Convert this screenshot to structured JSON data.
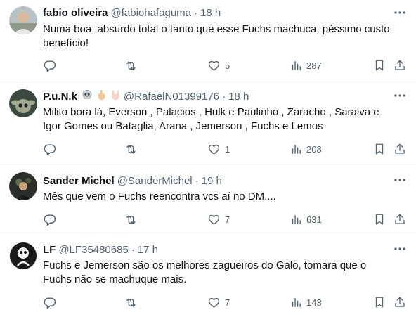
{
  "tweets": [
    {
      "name": "fabio oliveira",
      "handle": "@fabiohafaguma",
      "separator": "·",
      "time": "18 h",
      "text": "Numa boa, absurdo total o tanto que esse Fuchs machuca, péssimo custo benefício!",
      "likes": "5",
      "views": "287"
    },
    {
      "name": "P.u.N.k",
      "handle": "@RafaelN01399176",
      "separator": "·",
      "time": "18 h",
      "emoji_icons": [
        "skull-icon",
        "middle-finger-icon",
        "rock-hand-icon"
      ],
      "text": "Milito bora lá,  Everson , Palacios , Hulk e Paulinho , Zaracho , Saraiva e Igor Gomes ou Bataglia,  Arana , Jemerson , Fuchs e Lemos",
      "likes": "1",
      "views": "208"
    },
    {
      "name": "Sander Michel",
      "handle": "@SanderMichel",
      "separator": "·",
      "time": "19 h",
      "text": "Mês que vem o Fuchs reencontra vcs aí no DM....",
      "likes": "7",
      "views": "631"
    },
    {
      "name": "LF",
      "handle": "@LF35480685",
      "separator": "·",
      "time": "17 h",
      "text": "Fuchs e Jemerson são os melhores zagueiros do Galo, tomara que o Fuchs não se machuque mais.",
      "likes": "7",
      "views": "143"
    }
  ],
  "icons": [
    "more-icon",
    "reply-icon",
    "repost-icon",
    "like-icon",
    "views-icon",
    "bookmark-icon",
    "share-icon"
  ],
  "colors": {
    "text": "#0f1419",
    "secondary": "#536471",
    "border": "#eff3f4"
  }
}
